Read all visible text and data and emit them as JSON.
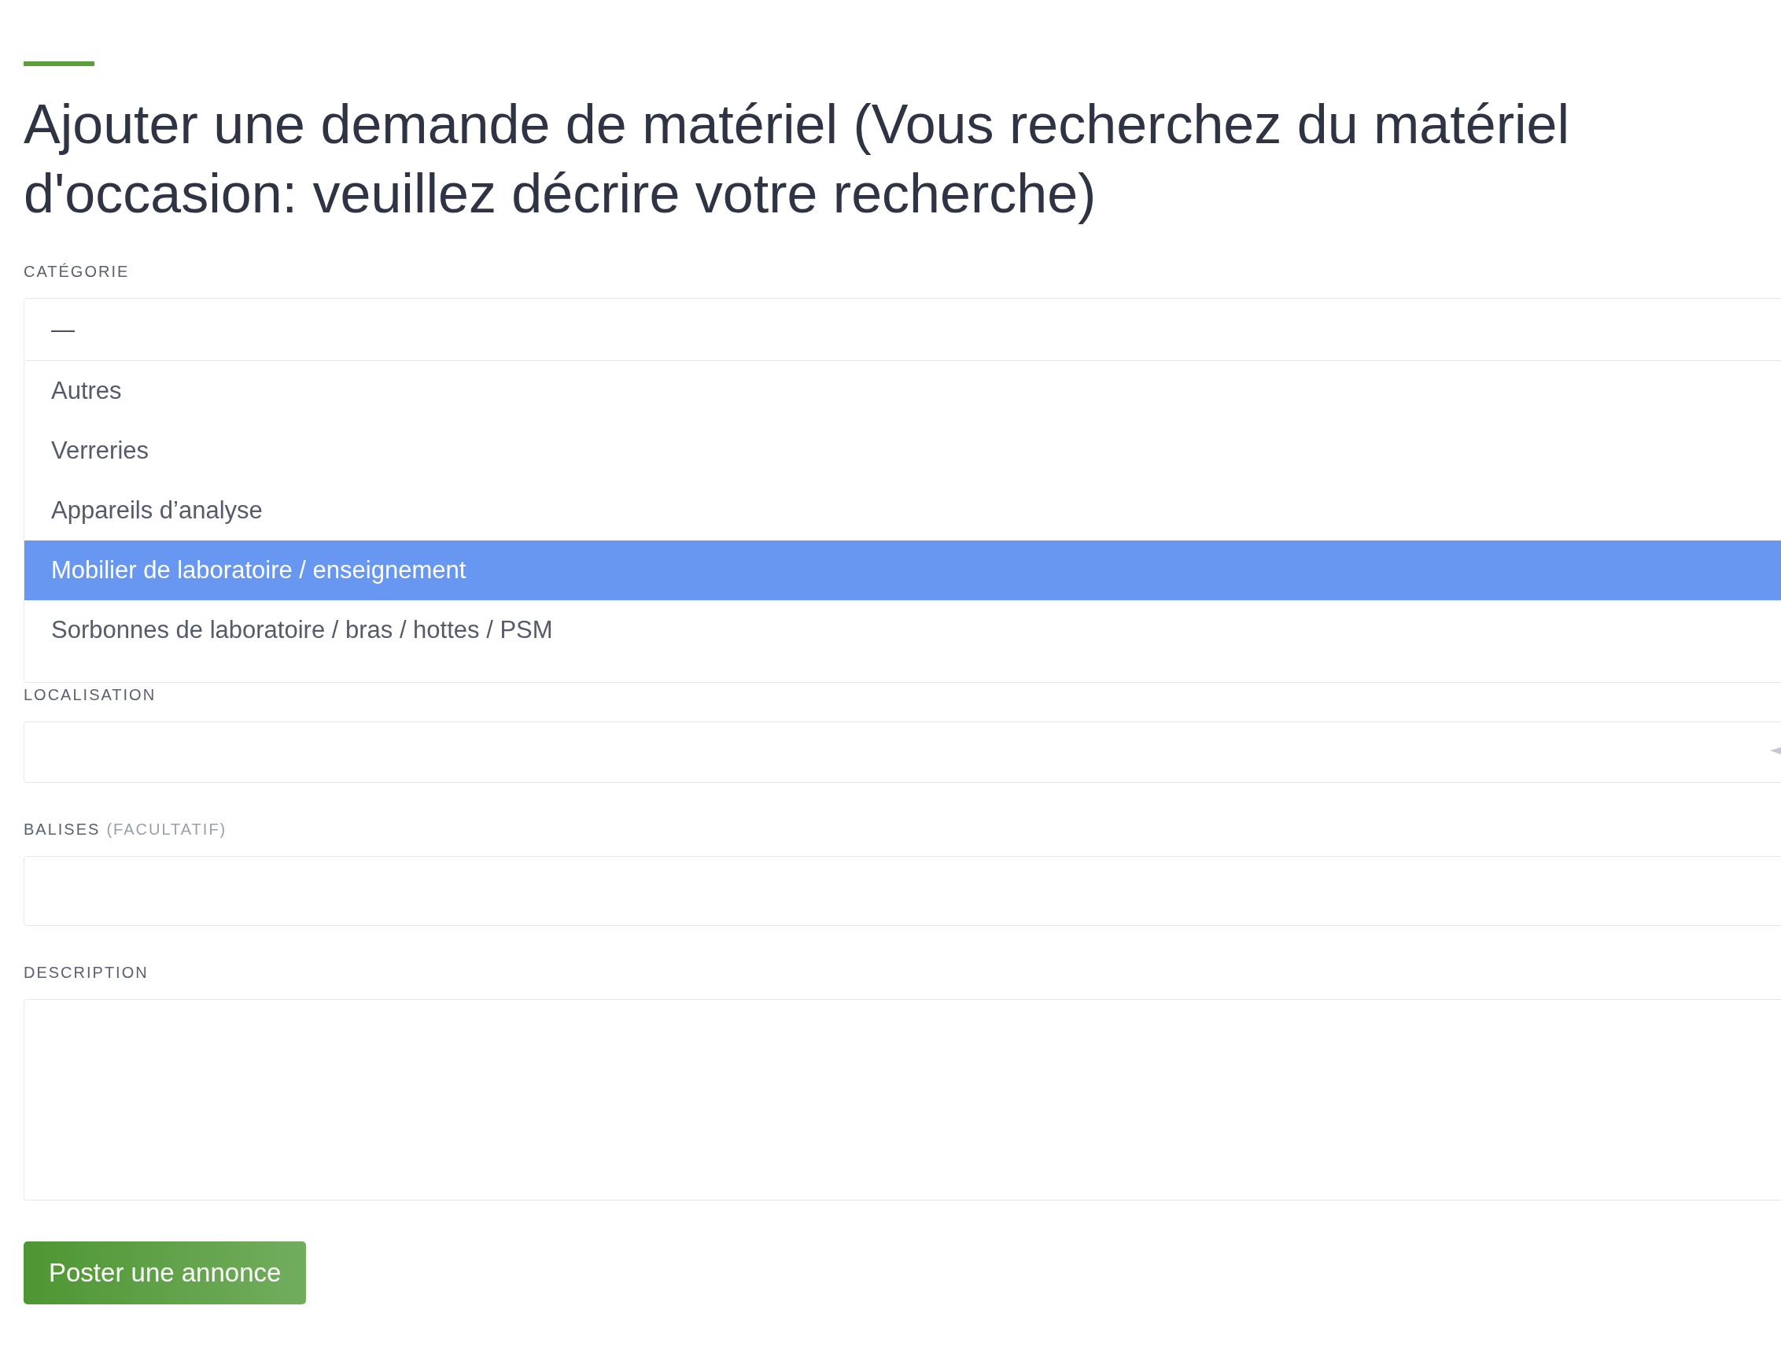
{
  "title": "Ajouter une demande de matériel (Vous recherchez du matériel d'occasion: veuillez décrire votre recherche)",
  "fields": [
    {
      "kind": "select",
      "label": "CATÉGORIE",
      "value": "—",
      "options": [
        {
          "label": "Autres",
          "selected": false
        },
        {
          "label": "Verreries",
          "selected": false
        },
        {
          "label": "Appareils d’analyse",
          "selected": false
        },
        {
          "label": "Mobilier de laboratoire / enseignement",
          "selected": true
        },
        {
          "label": "Sorbonnes de laboratoire / bras / hottes / PSM",
          "selected": false
        }
      ]
    },
    {
      "kind": "location",
      "label": "LOCALISATION"
    },
    {
      "kind": "input",
      "label": "BALISES",
      "note": "(FACULTATIF)"
    },
    {
      "kind": "textarea",
      "label": "DESCRIPTION"
    }
  ],
  "submit": "Poster une annonce"
}
